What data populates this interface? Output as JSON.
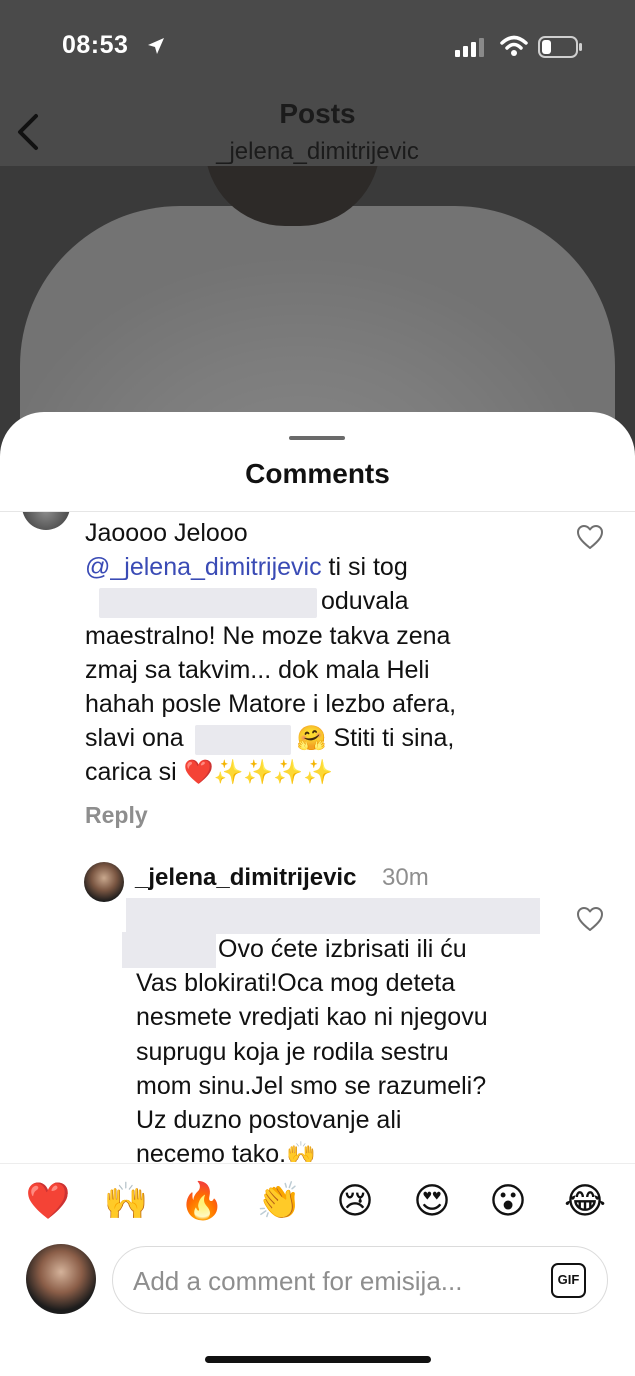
{
  "status_bar": {
    "time": "08:53"
  },
  "post_header": {
    "title": "Posts",
    "username": "_jelena_dimitrijevic"
  },
  "comments_sheet": {
    "title": "Comments",
    "comment": {
      "line1": "Jaoooo Jelooo",
      "mention": "@_jelena_dimitrijevic",
      "line2_rest": " ti si tog",
      "line3_rest": "oduvala",
      "line4": "maestralno! Ne moze takva zena",
      "line5": "zmaj sa takvim... dok mala Heli",
      "line6": "hahah posle Matore i lezbo afera,",
      "line7_start": "slavi ona ",
      "line7_emoji": "🤗",
      "line7_end": " Stiti ti sina,",
      "line8_start": "carica si ",
      "line8_emoji": "❤️✨✨✨✨",
      "reply_label": "Reply"
    },
    "reply": {
      "username": "_jelena_dimitrijevic",
      "time": "30m",
      "line1_rest": "Ovo ćete izbrisati ili ću",
      "line2": "Vas blokirati!Oca mog deteta",
      "line3": "nesmete vredjati kao ni njegovu",
      "line4": "suprugu koja je rodila sestru",
      "line5": "mom sinu.Jel smo se razumeli?",
      "line6": "Uz duzno postovanje ali",
      "line7": "necemo tako.",
      "line7_emoji": "🙌"
    }
  },
  "reactions": [
    "❤️",
    "🙌",
    "🔥",
    "👏",
    "😢",
    "😍",
    "😮",
    "😂"
  ],
  "composer": {
    "placeholder": "Add a comment for emisija...",
    "gif_label": "GIF"
  },
  "colors": {
    "mention": "#3a4bb5",
    "secondary_text": "#8e8e8e",
    "overlay": "#4a4a4a"
  }
}
